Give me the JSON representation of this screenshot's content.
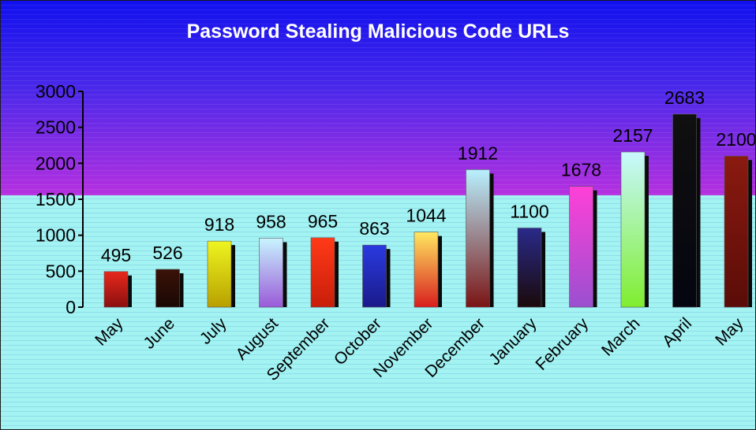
{
  "chart_data": {
    "type": "bar",
    "title": "Password Stealing Malicious Code URLs",
    "xlabel": "",
    "ylabel": "",
    "ylim": [
      0,
      3000
    ],
    "yticks": [
      0,
      500,
      1000,
      1500,
      2000,
      2500,
      3000
    ],
    "grid": false,
    "legend": "none",
    "categories": [
      "May",
      "June",
      "July",
      "August",
      "September",
      "October",
      "November",
      "December",
      "January",
      "February",
      "March",
      "April",
      "May"
    ],
    "values": [
      495,
      526,
      918,
      958,
      965,
      863,
      1044,
      1912,
      1100,
      1678,
      2157,
      2683,
      2100
    ],
    "bar_colors": [
      [
        "#e8281c",
        "#8a1010"
      ],
      [
        "#3a1208",
        "#1a0804"
      ],
      [
        "#eef520",
        "#b8a000"
      ],
      [
        "#c8f5ff",
        "#9a5ad8"
      ],
      [
        "#ff3a18",
        "#c81e0a"
      ],
      [
        "#2a3ae0",
        "#1a1a8a"
      ],
      [
        "#ffe860",
        "#d81e1e"
      ],
      [
        "#b8f0ff",
        "#7a1414"
      ],
      [
        "#2a2a8a",
        "#1a0a0a"
      ],
      [
        "#ff40d8",
        "#9a50d0"
      ],
      [
        "#c8f8ff",
        "#80ee30"
      ],
      [
        "#101010",
        "#050510"
      ],
      [
        "#8a1a10",
        "#5a0c08"
      ]
    ],
    "background_colors": {
      "top": "#1a18e6",
      "middle": "#b030e0",
      "bottom": "#a0f2f2"
    }
  }
}
